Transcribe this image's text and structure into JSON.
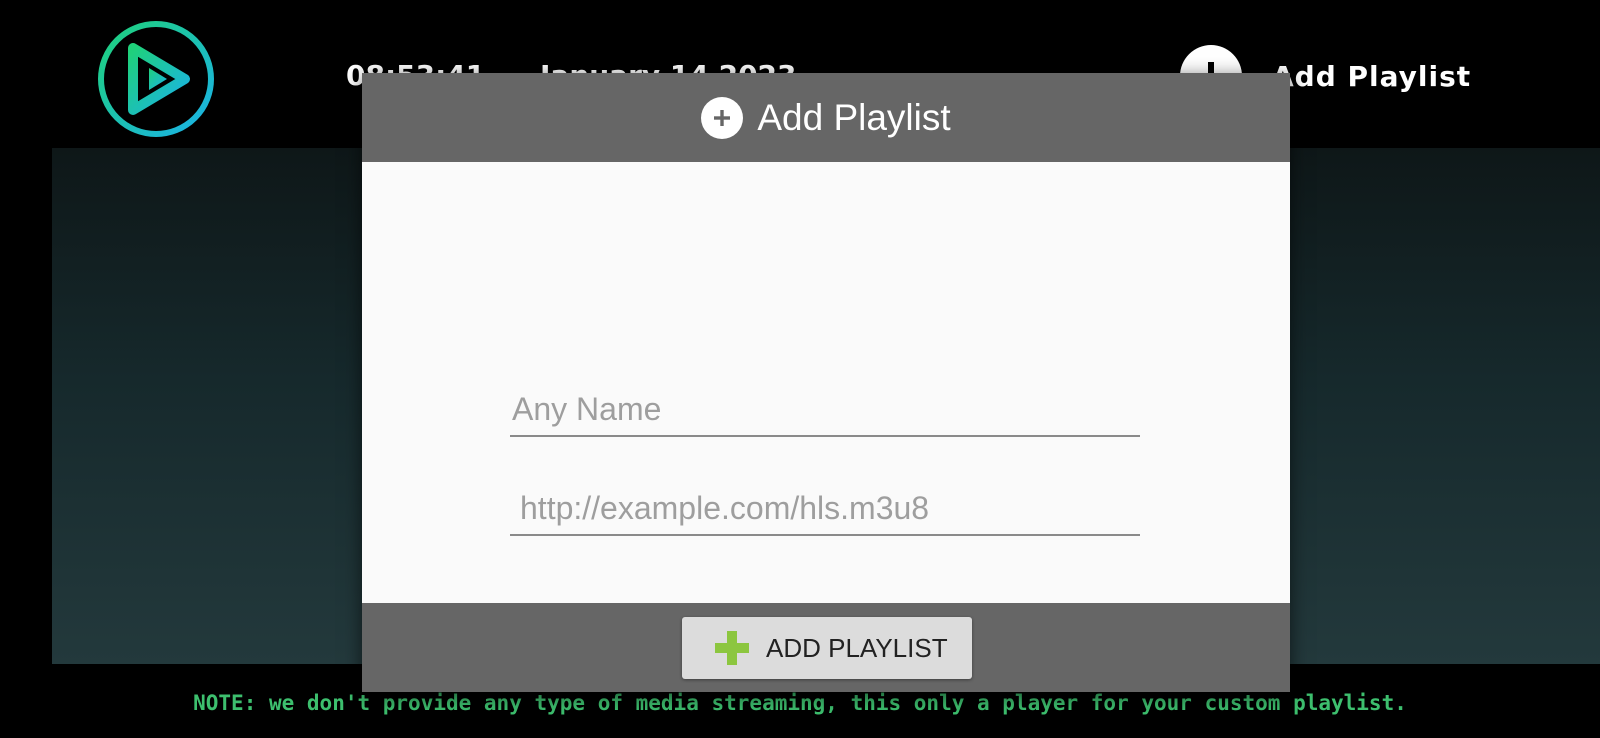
{
  "app": {
    "logo_icon": "play-logo-icon",
    "clock": "08:53:41",
    "date": "January 14 2023",
    "add_icon": "plus-circle-icon",
    "add_playlist_label": "Add  Playlist",
    "note": "NOTE: we don't provide any type of media streaming, this only a player for your custom playlist."
  },
  "dialog": {
    "header_icon": "plus-circle-icon",
    "title": "Add Playlist",
    "name_field": {
      "value": "",
      "placeholder": "Any Name"
    },
    "url_field": {
      "value": "",
      "placeholder": "http://example.com/hls.m3u8"
    },
    "submit_icon": "green-plus-icon",
    "submit_label": "ADD PLAYLIST"
  },
  "colors": {
    "note_text": "#3dbf6e",
    "dialog_bar": "#666666",
    "dialog_body": "#fafafa",
    "button_bg": "#dcdcdc",
    "green_plus": "#8cc63f",
    "logo_gradient_start": "#1fd17a",
    "logo_gradient_end": "#1ab2e8"
  }
}
